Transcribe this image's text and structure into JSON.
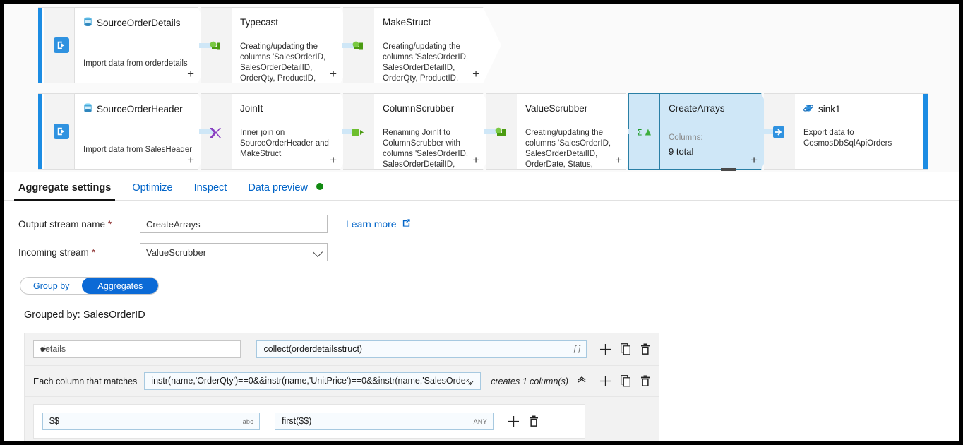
{
  "canvas": {
    "rows": [
      {
        "source": {
          "name": "SourceOrderDetails",
          "desc": "Import data from orderdetails",
          "icon": "sql-database-icon"
        },
        "nodes": [
          {
            "title": "Typecast",
            "desc": "Creating/updating the columns 'SalesOrderID, SalesOrderDetailID, OrderQty, ProductID, UnitPrice,",
            "icon": "derived-column-icon"
          },
          {
            "title": "MakeStruct",
            "desc": "Creating/updating the columns 'SalesOrderID, SalesOrderDetailID, OrderQty, ProductID, UnitPrice,",
            "icon": "derived-column-icon"
          }
        ]
      },
      {
        "source": {
          "name": "SourceOrderHeader",
          "desc": "Import data from SalesHeader",
          "icon": "sql-database-icon"
        },
        "nodes": [
          {
            "title": "JoinIt",
            "desc": "Inner join on SourceOrderHeader and MakeStruct",
            "icon": "join-icon"
          },
          {
            "title": "ColumnScrubber",
            "desc": "Renaming JoinIt to ColumnScrubber with columns 'SalesOrderID, SalesOrderDetailID, OrderDate,",
            "icon": "select-icon"
          },
          {
            "title": "ValueScrubber",
            "desc": "Creating/updating the columns 'SalesOrderID, SalesOrderDetailID, OrderDate, Status, SalesOrderNumber,",
            "icon": "derived-column-icon"
          },
          {
            "title": "CreateArrays",
            "sub_label": "Columns:",
            "sub_value": "9 total",
            "icon": "aggregate-icon",
            "selected": true
          },
          {
            "title": "sink1",
            "desc": "Export data to CosmosDbSqlApiOrders",
            "icon": "cosmos-db-icon"
          }
        ]
      }
    ],
    "plus_label": "+"
  },
  "tabs": [
    {
      "label": "Aggregate settings",
      "active": true,
      "dot": false
    },
    {
      "label": "Optimize",
      "active": false,
      "dot": false
    },
    {
      "label": "Inspect",
      "active": false,
      "dot": false
    },
    {
      "label": "Data preview",
      "active": false,
      "dot": true
    }
  ],
  "form": {
    "output_stream_label": "Output stream name",
    "output_stream_value": "CreateArrays",
    "incoming_stream_label": "Incoming stream",
    "incoming_stream_value": "ValueScrubber",
    "required_marker": "*",
    "learn_more": "Learn more"
  },
  "toggle": {
    "group_by": "Group by",
    "aggregates": "Aggregates",
    "selected": "Aggregates"
  },
  "grouped_by": "Grouped by: SalesOrderID",
  "aggregates": {
    "column_value": "details",
    "expression_value": "collect(orderdetailsstruct)",
    "expression_type": "[ ]"
  },
  "pattern": {
    "label": "Each column that matches",
    "expression": "instr(name,'OrderQty')==0&&instr(name,'UnitPrice')==0&&instr(name,'SalesOrder...",
    "creates": "creates 1 column(s)",
    "nested_name_value": "$$",
    "nested_name_type": "abc",
    "nested_expr_value": "first($$)",
    "nested_expr_type": "ANY"
  },
  "colors": {
    "accent_blue": "#0064c8",
    "selected_node": "#cfe7f7",
    "selected_border": "#2a7fa5",
    "source_stripe": "#1c8ce3",
    "status_green": "#128a12",
    "pill_on": "#0b6ad6"
  }
}
